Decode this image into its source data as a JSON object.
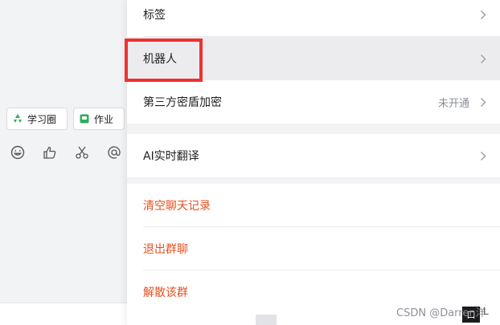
{
  "chat": {
    "chips": [
      {
        "label": "学习圈",
        "icon": "recycle-icon",
        "color": "#2bae5c"
      },
      {
        "label": "作业",
        "icon": "homework-icon",
        "color": "#2bae5c"
      }
    ],
    "tools": [
      "emoji-icon",
      "thumbs-up-icon",
      "scissors-icon",
      "mention-icon"
    ]
  },
  "settings": {
    "tags_label": "标签",
    "bot_label": "机器人",
    "vault_label": "第三方密盾加密",
    "vault_status": "未开通",
    "translate_label": "AI实时翻译",
    "clear_label": "清空聊天记录",
    "exit_label": "退出群聊",
    "dissolve_label": "解散该群"
  },
  "colors": {
    "danger": "#e5501f",
    "highlight_box": "#ef3131",
    "chip_icon": "#2bae5c"
  },
  "bottom": {
    "watermark": "CSDN @Darren洋",
    "dark_char": "口",
    "tail_char": "L"
  }
}
